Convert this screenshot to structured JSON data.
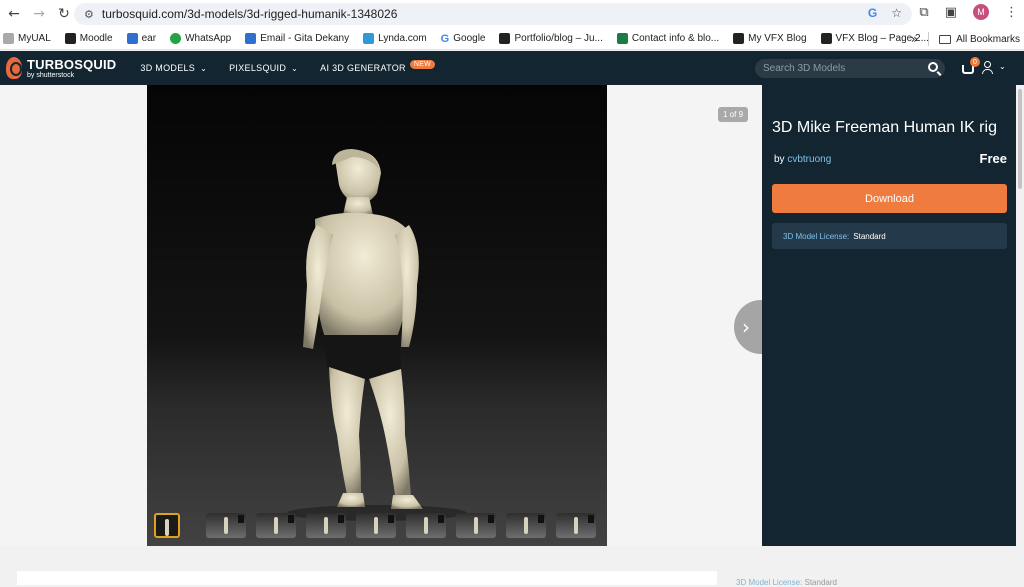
{
  "browser": {
    "url": "turbosquid.com/3d-models/3d-rigged-humanik-1348026",
    "profile_initial": "M",
    "bookmarks": [
      "MyUAL",
      "Moodle",
      "ear",
      "WhatsApp",
      "Email - Gita Dekany",
      "Lynda.com",
      "Google",
      "Portfolio/blog – Ju...",
      "Contact info & blo...",
      "My VFX Blog",
      "VFX Blog – Page 2..."
    ],
    "all_bookmarks_label": "All Bookmarks",
    "more_label": "»"
  },
  "site": {
    "logo_main": "TURBOSQUID",
    "logo_sub": "by shutterstock",
    "menu": [
      {
        "label": "3D MODELS",
        "chevron": "⌄"
      },
      {
        "label": "PIXELSQUID",
        "chevron": "⌄"
      },
      {
        "label": "AI 3D GENERATOR",
        "badge": "NEW"
      }
    ],
    "search_placeholder": "Search 3D Models",
    "cart_count": "0"
  },
  "viewer": {
    "counter": "1 of 9",
    "thumbnail_count": 9
  },
  "product": {
    "title": "3D Mike Freeman Human IK rig",
    "by_label": "by",
    "author": "cvbtruong",
    "price": "Free",
    "download_label": "Download",
    "license_label": "3D Model License:",
    "license_value": "Standard"
  },
  "lower": {
    "license_label": "3D Model License:",
    "license_value": "Standard"
  },
  "colors": {
    "header_bg": "#132530",
    "accent_orange": "#f07b3f",
    "link_blue": "#7fc0e8"
  }
}
